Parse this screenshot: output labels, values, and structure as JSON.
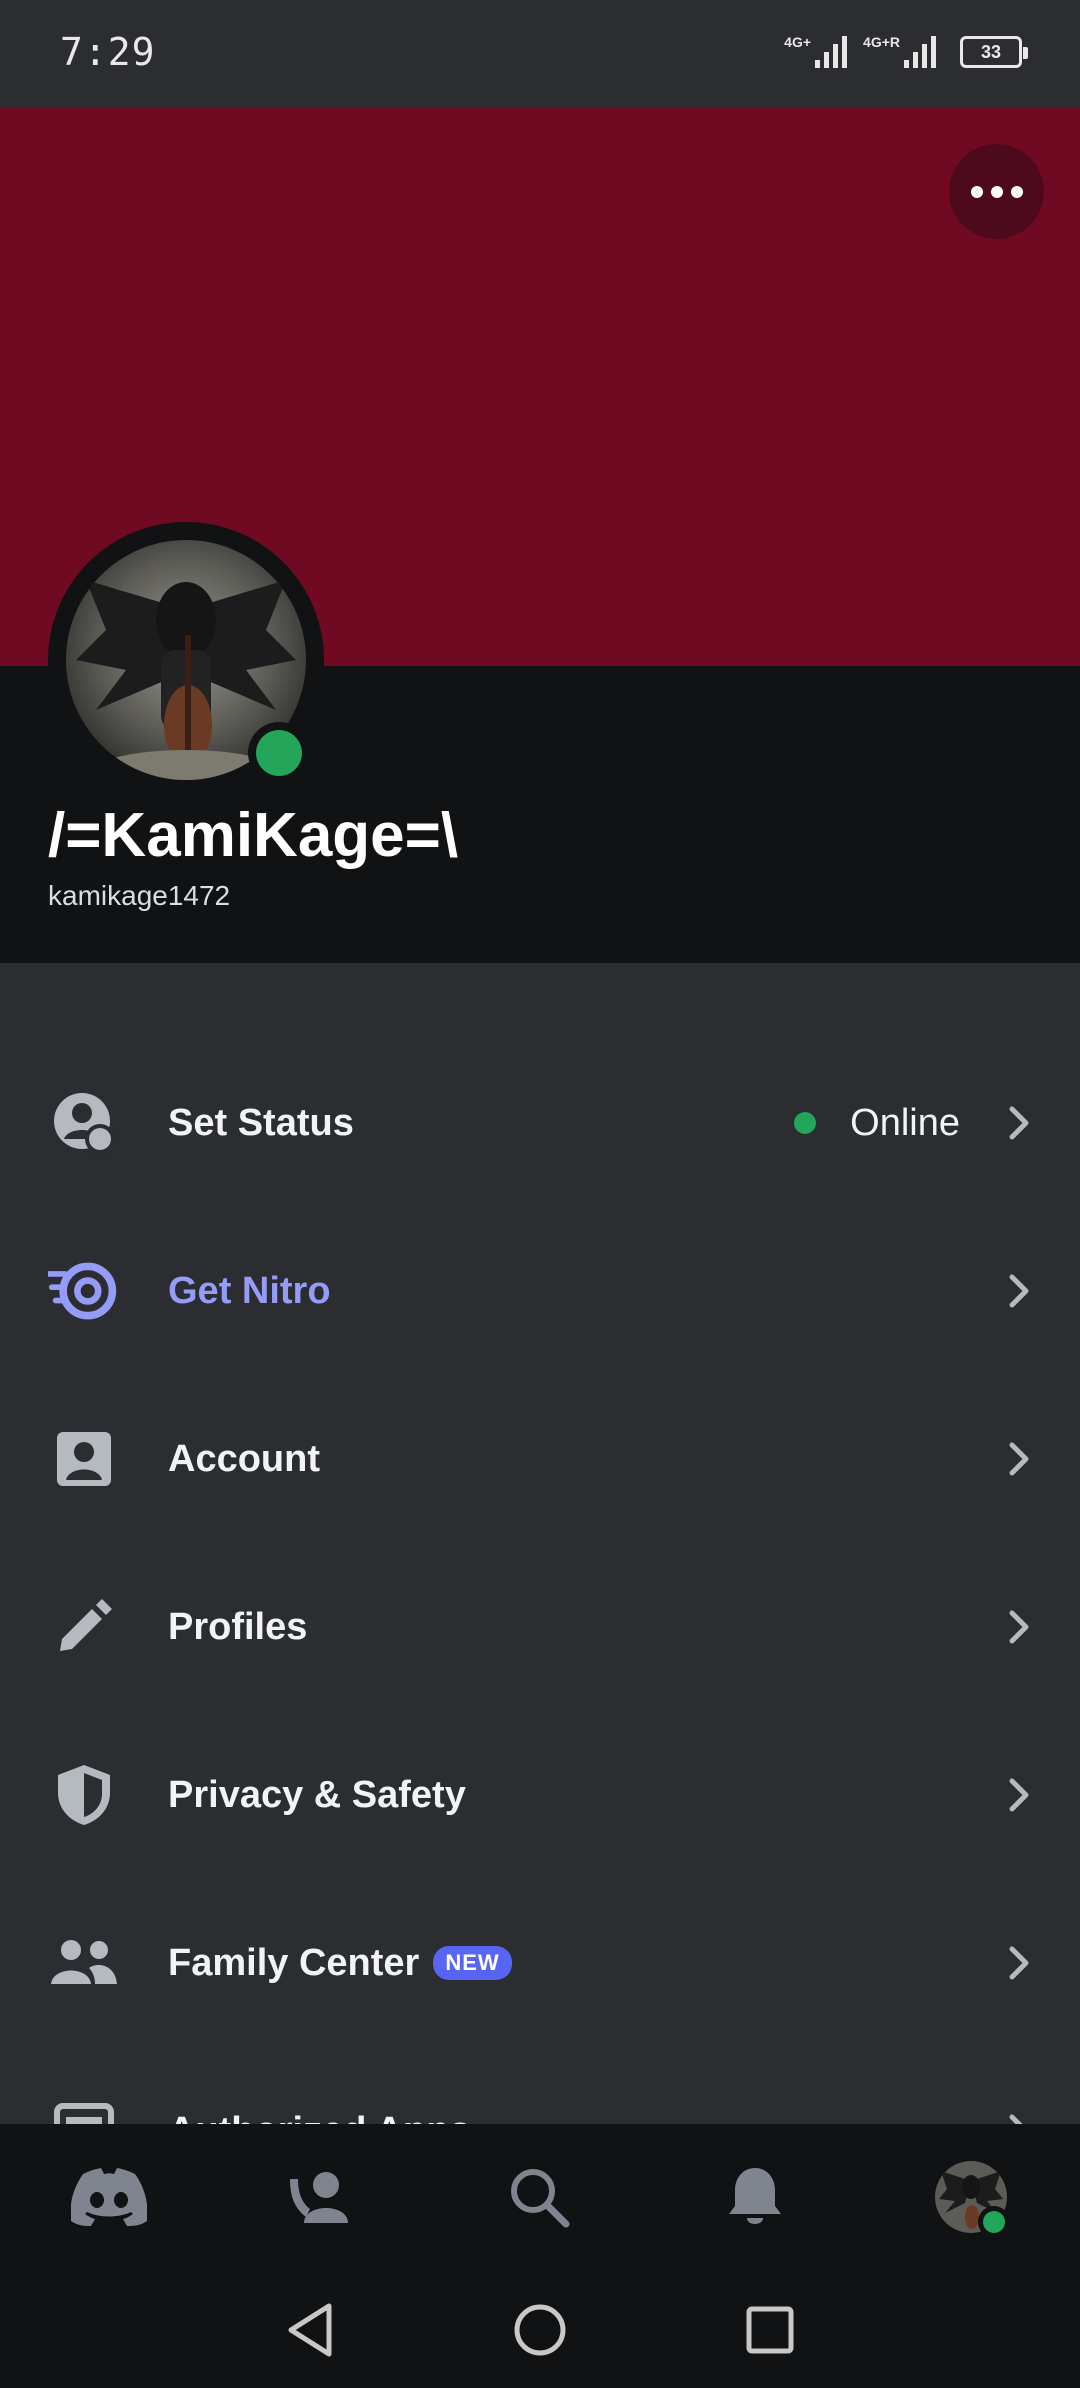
{
  "status_bar": {
    "time": "7:29",
    "network1": "4G+",
    "network2": "4G+R",
    "battery": "33"
  },
  "profile": {
    "display_name": "/=KamiKage=\\",
    "username": "kamikage1472",
    "banner_color": "#700a23",
    "presence_color": "#23a55a"
  },
  "settings": {
    "items": [
      {
        "label": "Set Status",
        "icon": "status-icon",
        "value": "Online"
      },
      {
        "label": "Get Nitro",
        "icon": "nitro-icon"
      },
      {
        "label": "Account",
        "icon": "account-icon"
      },
      {
        "label": "Profiles",
        "icon": "pencil-icon"
      },
      {
        "label": "Privacy & Safety",
        "icon": "shield-icon"
      },
      {
        "label": "Family Center",
        "icon": "family-icon",
        "badge": "NEW"
      },
      {
        "label": "Authorized Apps",
        "icon": "apps-icon"
      }
    ]
  },
  "bottom_nav": {
    "items": [
      "discord-home-icon",
      "friends-icon",
      "search-icon",
      "notifications-icon",
      "profile-avatar"
    ]
  },
  "colors": {
    "accent": "#5865f2",
    "nitro": "#949cf7",
    "background": "#2b2d31"
  }
}
